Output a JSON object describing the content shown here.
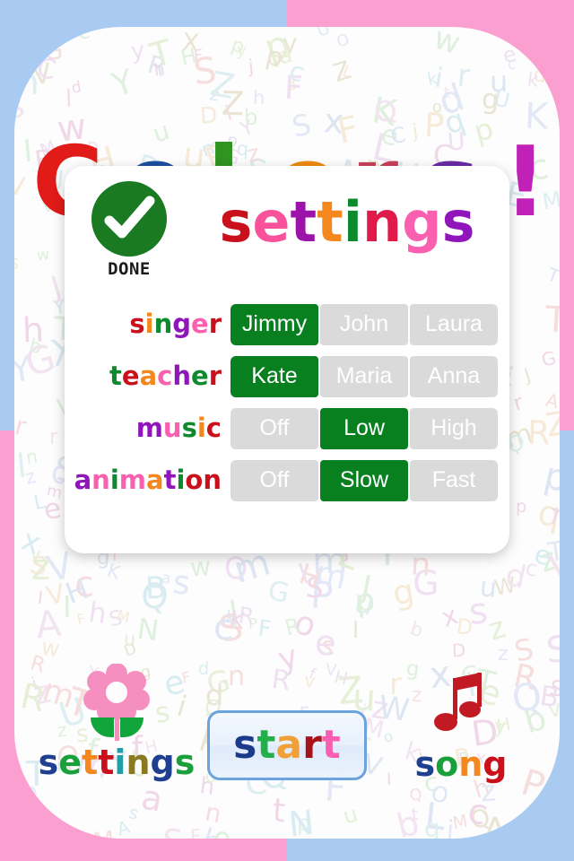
{
  "background": {
    "quadrant_colors": [
      "#a9cbf2",
      "#fb9ed0",
      "#fb9ed0",
      "#a9cbf2"
    ],
    "paper_color": "#fdfdfd",
    "pattern": "scattered-pastel-alphabet-letters",
    "pattern_letters": "ABCDEFGHIJKLMNOPQRSTUVWXYZabcdefghijklmnopqrstuvwxyz",
    "big_letters": [
      {
        "char": "C",
        "color": "#e01b18"
      },
      {
        "char": "o",
        "color": "#1b4fa0"
      },
      {
        "char": "l",
        "color": "#2f9420"
      },
      {
        "char": "o",
        "color": "#f08c13"
      },
      {
        "char": "r",
        "color": "#c9405c"
      },
      {
        "char": "s",
        "color": "#6c2aa6"
      },
      {
        "char": "!",
        "color": "#c221b8"
      }
    ]
  },
  "dialog": {
    "done_button": {
      "label": "DONE",
      "icon": "check-circle-icon",
      "color": "#1a7a22"
    },
    "title": {
      "text": "settings",
      "letters": [
        {
          "char": "s",
          "color": "#c9101b"
        },
        {
          "char": "e",
          "color": "#f9529b"
        },
        {
          "char": "t",
          "color": "#9b13a8"
        },
        {
          "char": "t",
          "color": "#f5871f"
        },
        {
          "char": "i",
          "color": "#0e8a2e"
        },
        {
          "char": "n",
          "color": "#e01b4a"
        },
        {
          "char": "g",
          "color": "#fb5fb0"
        },
        {
          "char": "s",
          "color": "#9016bb"
        }
      ]
    },
    "active_color": "#088020",
    "inactive_color": "#dadada",
    "rows": [
      {
        "name": "singer",
        "label_letters": [
          {
            "char": "s",
            "color": "#c9101b"
          },
          {
            "char": "i",
            "color": "#f5871f"
          },
          {
            "char": "n",
            "color": "#0e8a2e"
          },
          {
            "char": "g",
            "color": "#9016bb"
          },
          {
            "char": "e",
            "color": "#fb5fb0"
          },
          {
            "char": "r",
            "color": "#c9101b"
          }
        ],
        "options": [
          "Jimmy",
          "John",
          "Laura"
        ],
        "selected": "Jimmy",
        "selected_index": 0
      },
      {
        "name": "teacher",
        "label_letters": [
          {
            "char": "t",
            "color": "#0e8a2e"
          },
          {
            "char": "e",
            "color": "#c9101b"
          },
          {
            "char": "a",
            "color": "#f5871f"
          },
          {
            "char": "c",
            "color": "#fb5fb0"
          },
          {
            "char": "h",
            "color": "#9016bb"
          },
          {
            "char": "e",
            "color": "#0e8a2e"
          },
          {
            "char": "r",
            "color": "#c9101b"
          }
        ],
        "options": [
          "Kate",
          "Maria",
          "Anna"
        ],
        "selected": "Kate",
        "selected_index": 0
      },
      {
        "name": "music",
        "label_letters": [
          {
            "char": "m",
            "color": "#9016bb"
          },
          {
            "char": "u",
            "color": "#fb5fb0"
          },
          {
            "char": "s",
            "color": "#0e8a2e"
          },
          {
            "char": "i",
            "color": "#f5871f"
          },
          {
            "char": "c",
            "color": "#c9101b"
          }
        ],
        "options": [
          "Off",
          "Low",
          "High"
        ],
        "selected": "Low",
        "selected_index": 1
      },
      {
        "name": "animation",
        "label_letters": [
          {
            "char": "a",
            "color": "#9016bb"
          },
          {
            "char": "n",
            "color": "#fb5fb0"
          },
          {
            "char": "i",
            "color": "#0e8a2e"
          },
          {
            "char": "m",
            "color": "#fb5fb0"
          },
          {
            "char": "a",
            "color": "#f5871f"
          },
          {
            "char": "t",
            "color": "#9016bb"
          },
          {
            "char": "i",
            "color": "#0e8a2e"
          },
          {
            "char": "o",
            "color": "#c9101b"
          },
          {
            "char": "n",
            "color": "#c9101b"
          }
        ],
        "options": [
          "Off",
          "Slow",
          "Fast"
        ],
        "selected": "Slow",
        "selected_index": 1
      }
    ]
  },
  "bottom_bar": {
    "settings": {
      "icon": "flower-icon",
      "icon_colors": {
        "petals": "#f48fc0",
        "leaf": "#12a53c"
      },
      "label": "settings",
      "label_letters": [
        {
          "char": "s",
          "color": "#1f3f91"
        },
        {
          "char": "e",
          "color": "#19a03a"
        },
        {
          "char": "t",
          "color": "#f5871f"
        },
        {
          "char": "t",
          "color": "#c9101b"
        },
        {
          "char": "i",
          "color": "#1f9fa8"
        },
        {
          "char": "n",
          "color": "#8a7a1f"
        },
        {
          "char": "g",
          "color": "#1f3f91"
        },
        {
          "char": "s",
          "color": "#19a03a"
        }
      ]
    },
    "start_button": {
      "label": "start",
      "label_letters": [
        {
          "char": "s",
          "color": "#1b3a8a"
        },
        {
          "char": "t",
          "color": "#22b04a"
        },
        {
          "char": "a",
          "color": "#f0a03a"
        },
        {
          "char": "r",
          "color": "#a8131b"
        },
        {
          "char": "t",
          "color": "#f95fb0"
        }
      ],
      "border_color": "#6ba3dd"
    },
    "song": {
      "icon": "music-note-icon",
      "icon_color": "#c21a22",
      "label": "song",
      "label_letters": [
        {
          "char": "s",
          "color": "#1f3f91"
        },
        {
          "char": "o",
          "color": "#19a03a"
        },
        {
          "char": "n",
          "color": "#f5871f"
        },
        {
          "char": "g",
          "color": "#c9101b"
        }
      ]
    }
  }
}
